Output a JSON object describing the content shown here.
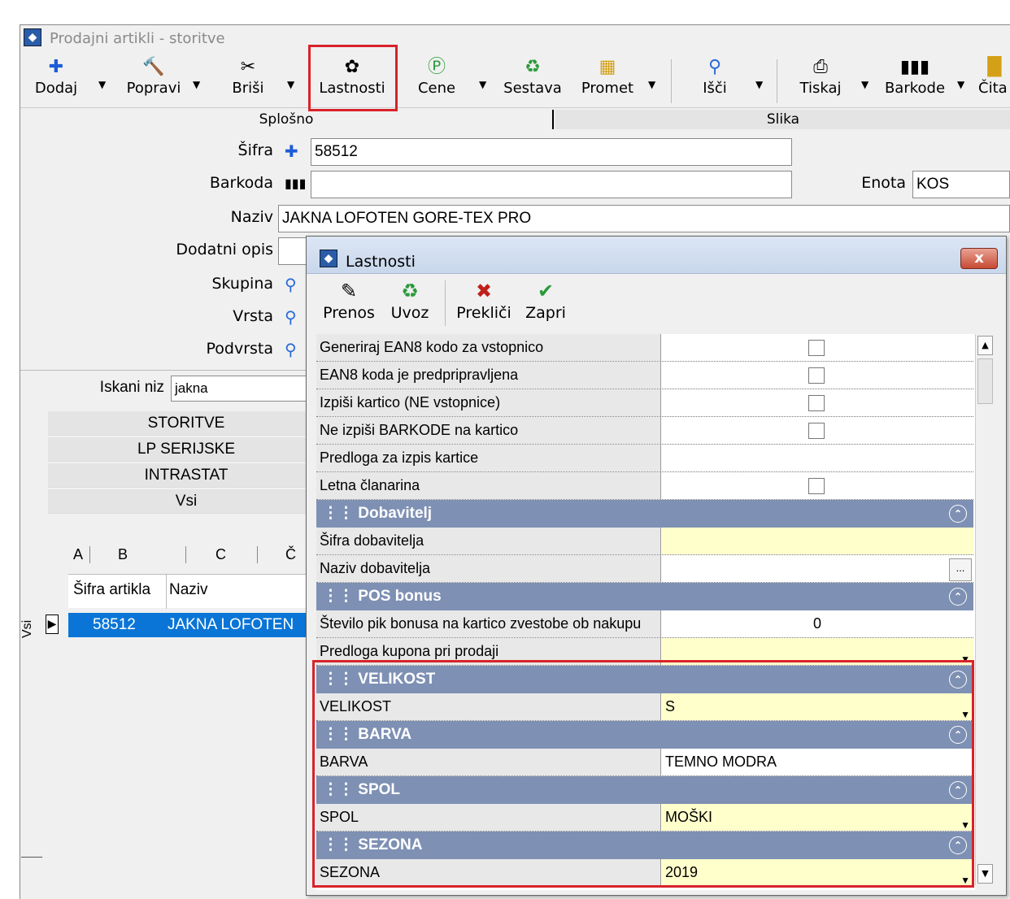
{
  "window": {
    "title": "Prodajni artikli - storitve"
  },
  "toolbar": [
    {
      "label": "Dodaj",
      "icon": "plus-icon"
    },
    {
      "label": "Popravi",
      "icon": "hammer-icon"
    },
    {
      "label": "Briši",
      "icon": "scissors-icon"
    },
    {
      "label": "Lastnosti",
      "icon": "properties-icon"
    },
    {
      "label": "Cene",
      "icon": "dollar-icon"
    },
    {
      "label": "Sestava",
      "icon": "recycle-icon"
    },
    {
      "label": "Promet",
      "icon": "traffic-icon"
    },
    {
      "label": "Išči",
      "icon": "search-icon"
    },
    {
      "label": "Tiskaj",
      "icon": "printer-icon"
    },
    {
      "label": "Barkode",
      "icon": "barcode-icon"
    },
    {
      "label": "Čita",
      "icon": "reader-icon"
    }
  ],
  "tabs": {
    "general": "Splošno",
    "image": "Slika"
  },
  "form": {
    "code_label": "Šifra",
    "code_value": "58512",
    "barcode_label": "Barkoda",
    "barcode_value": "",
    "unit_label": "Enota",
    "unit_value": "KOS",
    "name_label": "Naziv",
    "name_value": "JAKNA LOFOTEN GORE-TEX PRO",
    "extra_label": "Dodatni opis",
    "group_label": "Skupina",
    "type_label": "Vrsta",
    "subtype_label": "Podvrsta",
    "search_label": "Iskani niz",
    "search_value": "jakna"
  },
  "groups": [
    "STORITVE",
    "LP SERIJSKE",
    "INTRASTAT",
    "Vsi"
  ],
  "alpha_tabs": [
    "A",
    "B",
    "C",
    "Č"
  ],
  "list": {
    "col_code": "Šifra artikla",
    "col_name": "Naziv",
    "row_code": "58512",
    "row_name": "JAKNA LOFOTEN",
    "side_label": "Vsi"
  },
  "dialog": {
    "title": "Lastnosti",
    "toolbar": [
      {
        "label": "Prenos",
        "icon": "transfer-icon"
      },
      {
        "label": "Uvoz",
        "icon": "import-icon"
      },
      {
        "label": "Prekliči",
        "icon": "cancel-x-icon"
      },
      {
        "label": "Zapri",
        "icon": "checkmark-icon"
      }
    ],
    "close": "x",
    "rows": [
      {
        "kind": "prop",
        "key": "Generiraj EAN8 kodo za vstopnico",
        "type": "checkbox"
      },
      {
        "kind": "prop",
        "key": "EAN8 koda je predpripravljena",
        "type": "checkbox"
      },
      {
        "kind": "prop",
        "key": "Izpiši kartico (NE vstopnice)",
        "type": "checkbox"
      },
      {
        "kind": "prop",
        "key": "Ne izpiši BARKODE na kartico",
        "type": "checkbox"
      },
      {
        "kind": "prop",
        "key": "Predloga za izpis kartice",
        "type": "text",
        "value": ""
      },
      {
        "kind": "prop",
        "key": "Letna članarina",
        "type": "checkbox"
      },
      {
        "kind": "cat",
        "key": "Dobavitelj"
      },
      {
        "kind": "prop",
        "key": "Šifra dobavitelja",
        "type": "text",
        "value": "",
        "yellow": true
      },
      {
        "kind": "prop",
        "key": "Naziv dobavitelja",
        "type": "ellipsis",
        "value": "..."
      },
      {
        "kind": "cat",
        "key": "POS bonus"
      },
      {
        "kind": "prop",
        "key": "Število pik bonusa na kartico zvestobe ob nakupu",
        "type": "number",
        "value": "0"
      },
      {
        "kind": "prop",
        "key": "Predloga kupona pri prodaji",
        "type": "dropdown",
        "value": "",
        "yellow": true
      },
      {
        "kind": "cat",
        "key": "VELIKOST"
      },
      {
        "kind": "prop",
        "key": "VELIKOST",
        "type": "dropdown",
        "value": "S",
        "yellow": true
      },
      {
        "kind": "cat",
        "key": "BARVA"
      },
      {
        "kind": "prop",
        "key": "BARVA",
        "type": "text",
        "value": "TEMNO MODRA"
      },
      {
        "kind": "cat",
        "key": "SPOL"
      },
      {
        "kind": "prop",
        "key": "SPOL",
        "type": "dropdown",
        "value": "MOŠKI",
        "yellow": true
      },
      {
        "kind": "cat",
        "key": "SEZONA"
      },
      {
        "kind": "prop",
        "key": "SEZONA",
        "type": "dropdown",
        "value": "2019",
        "yellow": true
      }
    ]
  },
  "colors": {
    "highlight": "#d8232a",
    "category": "#7e90b3",
    "yellow": "#ffffcc",
    "selection": "#0a75d6"
  }
}
